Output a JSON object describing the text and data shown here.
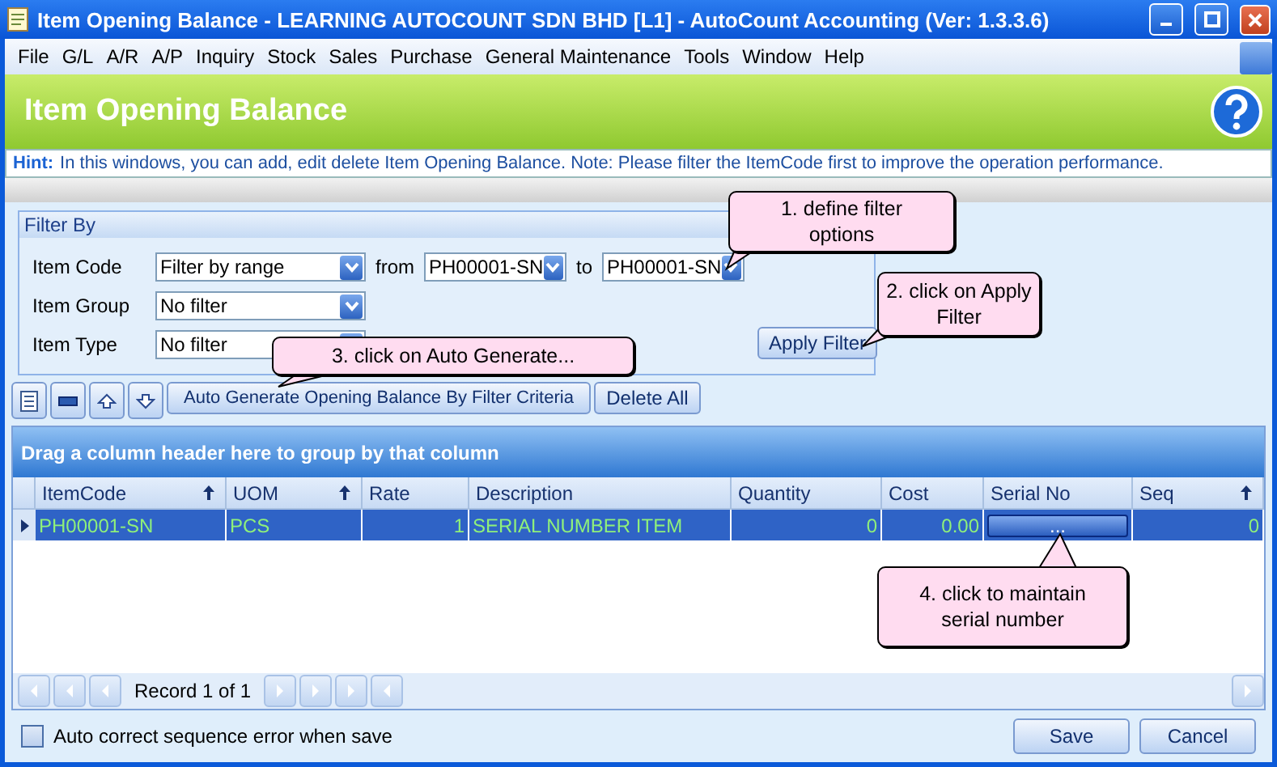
{
  "window": {
    "title": "Item Opening Balance - LEARNING AUTOCOUNT SDN BHD [L1] - AutoCount Accounting (Ver: 1.3.3.6)"
  },
  "menu": [
    "File",
    "G/L",
    "A/R",
    "A/P",
    "Inquiry",
    "Stock",
    "Sales",
    "Purchase",
    "General Maintenance",
    "Tools",
    "Window",
    "Help"
  ],
  "header": {
    "title": "Item Opening Balance"
  },
  "hint": {
    "label": "Hint:",
    "text": "In this windows, you can add, edit  delete Item Opening Balance. Note: Please filter the ItemCode first to improve the operation performance."
  },
  "filter": {
    "title": "Filter By",
    "rows": [
      {
        "label": "Item Code",
        "value": "Filter by range",
        "from_label": "from",
        "from": "PH00001-SN",
        "to_label": "to",
        "to": "PH00001-SN"
      },
      {
        "label": "Item Group",
        "value": "No filter"
      },
      {
        "label": "Item Type",
        "value": "No filter"
      }
    ],
    "apply_button": "Apply Filter"
  },
  "toolbar": {
    "generate_button": "Auto Generate Opening Balance By Filter Criteria",
    "delete_button": "Delete All"
  },
  "grid": {
    "group_panel": "Drag a column header here to group by that column",
    "columns": [
      {
        "label": "ItemCode",
        "sorted": true,
        "kind": "text"
      },
      {
        "label": "UOM",
        "sorted": true,
        "kind": "text"
      },
      {
        "label": "Rate",
        "sorted": false,
        "kind": "number"
      },
      {
        "label": "Description",
        "sorted": false,
        "kind": "text"
      },
      {
        "label": "Quantity",
        "sorted": false,
        "kind": "number"
      },
      {
        "label": "Cost",
        "sorted": false,
        "kind": "number"
      },
      {
        "label": "Serial No",
        "sorted": false,
        "kind": "button"
      },
      {
        "label": "Seq",
        "sorted": true,
        "kind": "number"
      }
    ],
    "rows": [
      {
        "selected": true,
        "cells": [
          "PH00001-SN",
          "PCS",
          "1",
          "SERIAL NUMBER ITEM",
          "0",
          "0.00",
          "...",
          "0"
        ]
      }
    ],
    "record": "Record 1 of 1"
  },
  "footer": {
    "checkbox": {
      "label": "Auto correct sequence error when save",
      "checked": false
    },
    "buttons": [
      "Save",
      "Cancel"
    ]
  },
  "callouts": [
    {
      "text": "1. define filter options"
    },
    {
      "text": "2. click on Apply Filter"
    },
    {
      "text": "3. click on Auto Generate..."
    },
    {
      "text": "4. click to maintain serial number"
    }
  ]
}
